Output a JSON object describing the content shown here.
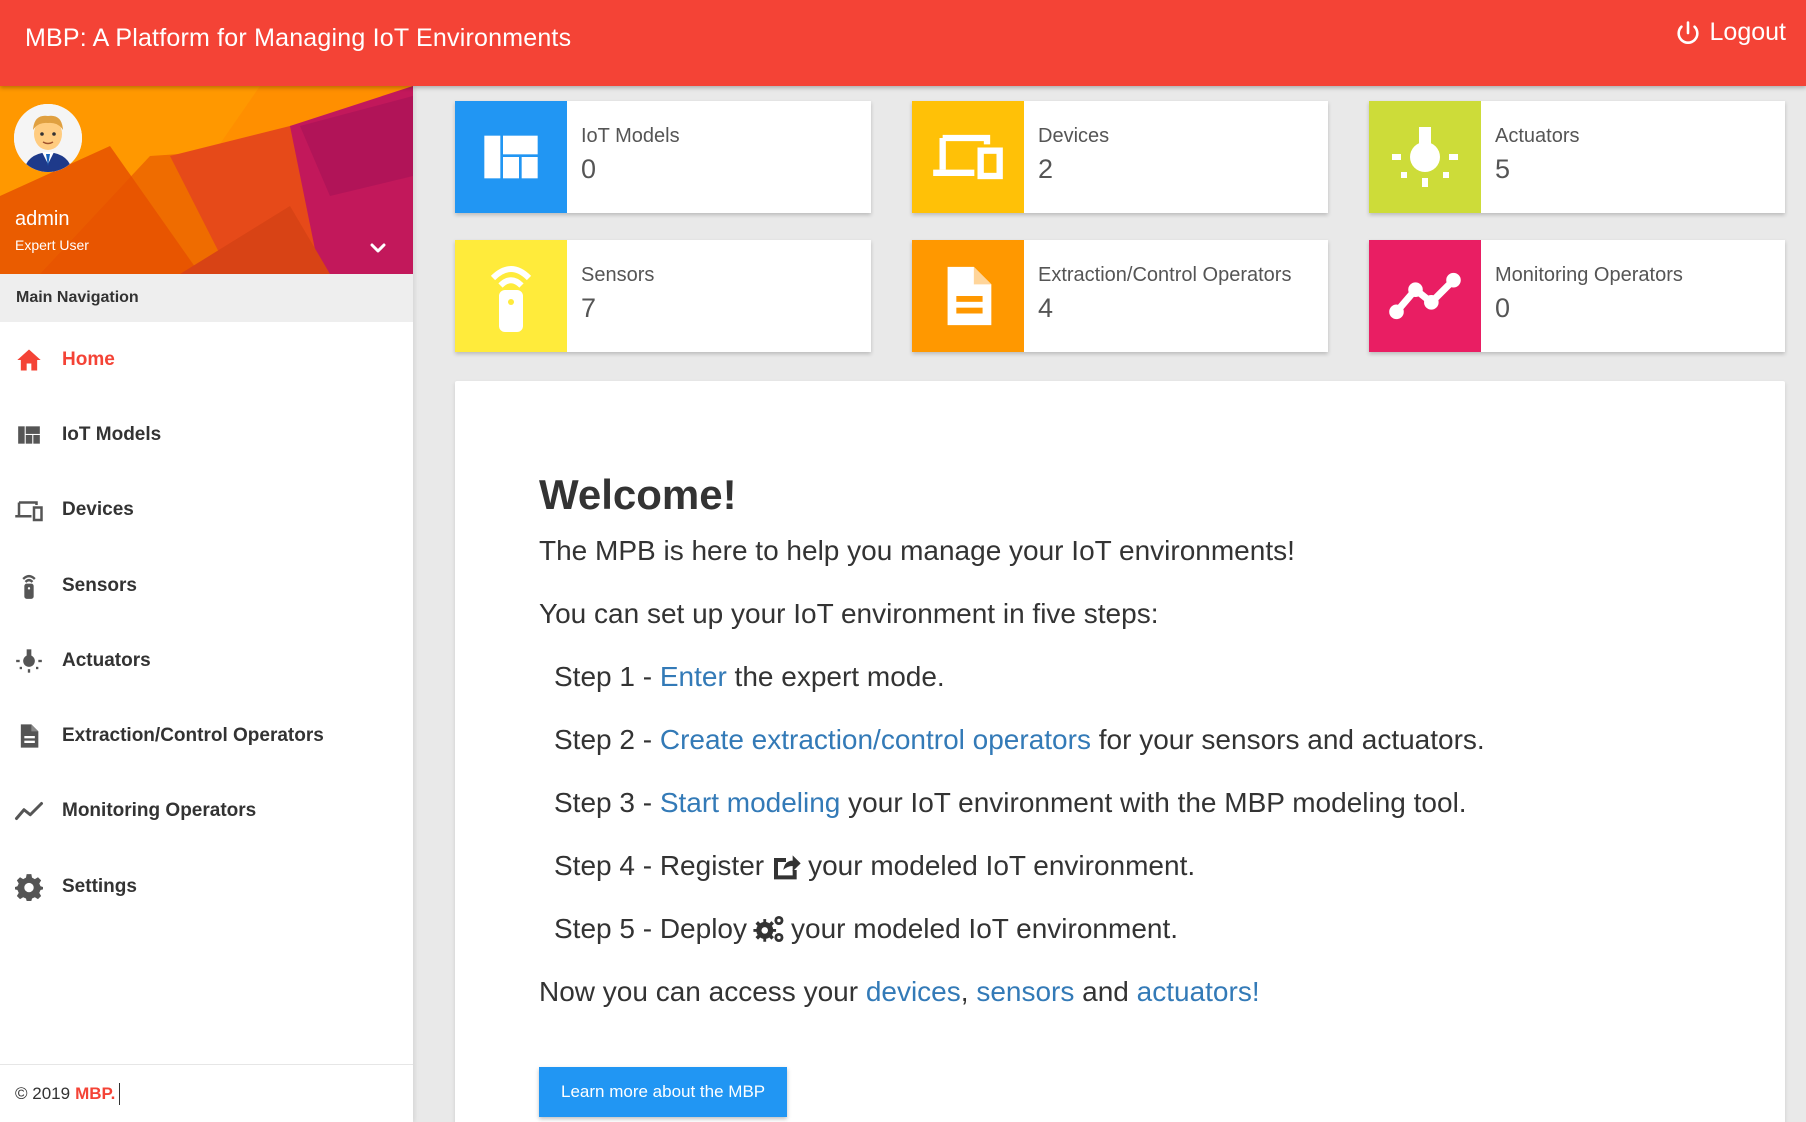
{
  "header": {
    "title": "MBP: A Platform for Managing IoT Environments",
    "logout_label": "Logout",
    "color": "#f44336"
  },
  "user": {
    "name": "admin",
    "role": "Expert User"
  },
  "sidebar": {
    "heading": "Main Navigation",
    "items": [
      {
        "label": "Home",
        "icon": "home-icon",
        "active": true
      },
      {
        "label": "IoT Models",
        "icon": "dashboard-icon"
      },
      {
        "label": "Devices",
        "icon": "devices-icon"
      },
      {
        "label": "Sensors",
        "icon": "sensor-remote-icon"
      },
      {
        "label": "Actuators",
        "icon": "lightbulb-icon"
      },
      {
        "label": "Extraction/Control Operators",
        "icon": "document-icon"
      },
      {
        "label": "Monitoring Operators",
        "icon": "trend-line-icon"
      },
      {
        "label": "Settings",
        "icon": "gear-icon"
      }
    ],
    "footer": {
      "copyright": "© 2019",
      "brand": "MBP."
    }
  },
  "info_boxes": [
    {
      "label": "IoT Models",
      "value": "0",
      "color": "#2196f3",
      "icon": "dashboard-icon"
    },
    {
      "label": "Devices",
      "value": "2",
      "color": "#ffc107",
      "icon": "devices-icon"
    },
    {
      "label": "Actuators",
      "value": "5",
      "color": "#cddc39",
      "icon": "lightbulb-icon"
    },
    {
      "label": "Sensors",
      "value": "7",
      "color": "#ffeb3b",
      "icon": "sensor-remote-icon"
    },
    {
      "label": "Extraction/Control Operators",
      "value": "4",
      "color": "#ff9800",
      "icon": "document-icon"
    },
    {
      "label": "Monitoring Operators",
      "value": "0",
      "color": "#e91e63",
      "icon": "trend-line-icon"
    }
  ],
  "welcome": {
    "title": "Welcome!",
    "intro": "The MPB is here to help you manage your IoT environments!",
    "steps_intro": "You can set up your IoT environment in five steps:",
    "step1": {
      "prefix": "Step 1 - ",
      "link": "Enter",
      "suffix": " the expert mode."
    },
    "step2": {
      "prefix": "Step 2 - ",
      "link": "Create extraction/control operators",
      "suffix": " for your sensors and actuators."
    },
    "step3": {
      "prefix": "Step 3 - ",
      "link": "Start modeling",
      "suffix": " your IoT environment with the MBP modeling tool."
    },
    "step4": {
      "prefix": "Step 4 - Register",
      "suffix": "your modeled IoT environment."
    },
    "step5": {
      "prefix": "Step 5 - Deploy",
      "suffix": "your modeled IoT environment."
    },
    "access": {
      "prefix": "Now you can access your ",
      "devices": "devices",
      "comma": ",",
      "sensors": "sensors",
      "and": " and ",
      "actuators": "actuators!"
    },
    "learn_more": "Learn more about the MBP"
  }
}
